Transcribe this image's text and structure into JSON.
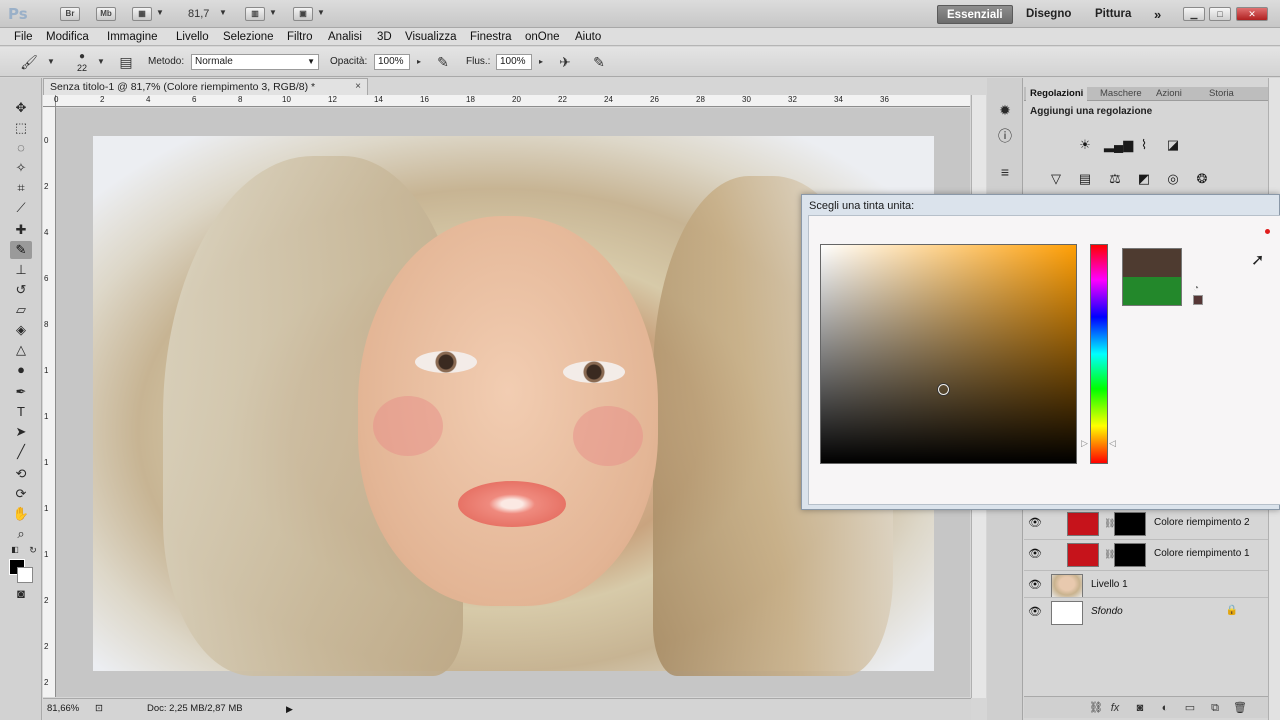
{
  "titlebar": {
    "logo": "Ps",
    "br_label": "Br",
    "mb_label": "Mb",
    "zoom": "81,7",
    "workspaces": [
      "Essenziali",
      "Disegno",
      "Pittura"
    ],
    "more": "»"
  },
  "menu": [
    "File",
    "Modifica",
    "Immagine",
    "Livello",
    "Selezione",
    "Filtro",
    "Analisi",
    "3D",
    "Visualizza",
    "Finestra",
    "onOne",
    "Aiuto"
  ],
  "options": {
    "brush_size": "22",
    "mode_label": "Metodo:",
    "mode_value": "Normale",
    "opacity_label": "Opacità:",
    "opacity_value": "100%",
    "flow_label": "Flus.:",
    "flow_value": "100%"
  },
  "document": {
    "tab_title": "Senza titolo-1 @ 81,7% (Colore riempimento 3, RGB/8) *",
    "close": "×",
    "ruler_top": [
      "0",
      "2",
      "4",
      "6",
      "8",
      "10",
      "12",
      "14",
      "16",
      "18",
      "20",
      "22",
      "24",
      "26",
      "28",
      "30",
      "32",
      "34",
      "36"
    ],
    "ruler_left": [
      "0",
      "2",
      "4",
      "6",
      "8",
      "1",
      "1",
      "1",
      "1",
      "1",
      "2",
      "2",
      "2"
    ],
    "zoom_status": "81,66%",
    "doc_size": "Doc: 2,25 MB/2,87 MB"
  },
  "panels": {
    "tabs": [
      "Regolazioni",
      "Maschere",
      "Azioni",
      "Storia"
    ],
    "adjust_title": "Aggiungi una regolazione",
    "layers": [
      {
        "name": "Colore riempimento 2",
        "thumb": "red",
        "mask": true
      },
      {
        "name": "Colore riempimento 1",
        "thumb": "red",
        "mask": true
      },
      {
        "name": "Livello 1",
        "thumb": "face",
        "mask": false
      },
      {
        "name": "Sfondo",
        "thumb": "white",
        "mask": false,
        "locked": true
      }
    ]
  },
  "picker": {
    "title": "Scegli una tinta unita:",
    "new_color": "#4e3b30",
    "current_color": "#23882b",
    "hue_color": "#ff9f06"
  },
  "colors": {
    "foreground": "#000000",
    "background": "#ffffff",
    "fill_red": "#c6131b"
  }
}
